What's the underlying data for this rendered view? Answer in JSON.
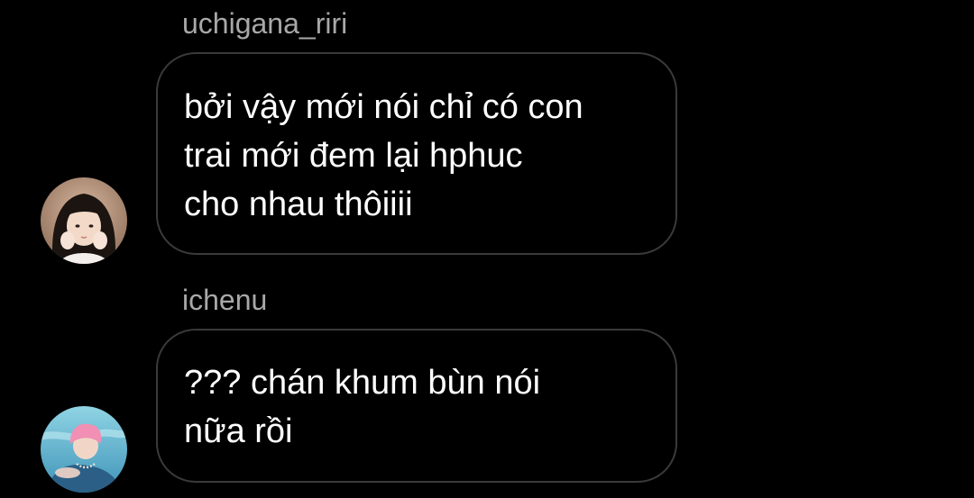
{
  "messages": [
    {
      "sender": "uchigana_riri",
      "text": "bởi vậy mới nói chỉ có con\ntrai mới đem lại hphuc\ncho nhau thôiiii",
      "avatar": "girl-portrait-avatar"
    },
    {
      "sender": "ichenu",
      "text": "??? chán khum bùn nói\nnữa rồi",
      "avatar": "pink-hair-boy-avatar"
    }
  ],
  "colors": {
    "background": "#000000",
    "sender_name": "#a8a8a8",
    "bubble_border": "#3a3a3a",
    "message_text": "#ffffff"
  }
}
